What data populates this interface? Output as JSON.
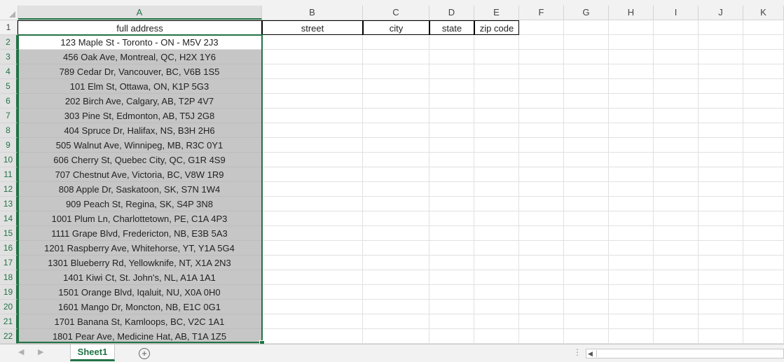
{
  "columns": [
    "A",
    "B",
    "C",
    "D",
    "E",
    "F",
    "G",
    "H",
    "I",
    "J",
    "K"
  ],
  "header_row": [
    "full address",
    "street",
    "city",
    "state",
    "zip code"
  ],
  "rows": [
    "123 Maple St - Toronto - ON - M5V 2J3",
    "456 Oak Ave, Montreal, QC, H2X 1Y6",
    "789 Cedar Dr, Vancouver, BC, V6B 1S5",
    "101 Elm St, Ottawa, ON, K1P 5G3",
    "202 Birch Ave, Calgary, AB, T2P 4V7",
    "303 Pine St, Edmonton, AB, T5J 2G8",
    "404 Spruce Dr, Halifax, NS, B3H 2H6",
    "505 Walnut Ave, Winnipeg, MB, R3C 0Y1",
    "606 Cherry St, Quebec City, QC, G1R 4S9",
    "707 Chestnut Ave, Victoria, BC, V8W 1R9",
    "808 Apple Dr, Saskatoon, SK, S7N 1W4",
    "909 Peach St, Regina, SK, S4P 3N8",
    "1001 Plum Ln, Charlottetown, PE, C1A 4P3",
    "1111 Grape Blvd, Fredericton, NB, E3B 5A3",
    "1201 Raspberry Ave, Whitehorse, YT, Y1A 5G4",
    "1301 Blueberry Rd, Yellowknife, NT, X1A 2N3",
    "1401 Kiwi Ct, St. John's, NL, A1A 1A1",
    "1501 Orange Blvd, Iqaluit, NU, X0A 0H0",
    "1601 Mango Dr, Moncton, NB, E1C 0G1",
    "1701 Banana St, Kamloops, BC, V2C 1A1",
    "1801 Pear Ave, Medicine Hat, AB, T1A 1Z5"
  ],
  "row_numbers": [
    "1",
    "2",
    "3",
    "4",
    "5",
    "6",
    "7",
    "8",
    "9",
    "10",
    "11",
    "12",
    "13",
    "14",
    "15",
    "16",
    "17",
    "18",
    "19",
    "20",
    "21",
    "22"
  ],
  "sheet_tabs": [
    "Sheet1"
  ],
  "add_sheet_symbol": "+",
  "nav_prev_symbol": "◀",
  "nav_next_symbol": "▶",
  "scroll_left_symbol": "◀",
  "divider_symbol": "⋮",
  "accent_color": "#217346",
  "selected_column": "A",
  "selected_range": "A2:A22"
}
